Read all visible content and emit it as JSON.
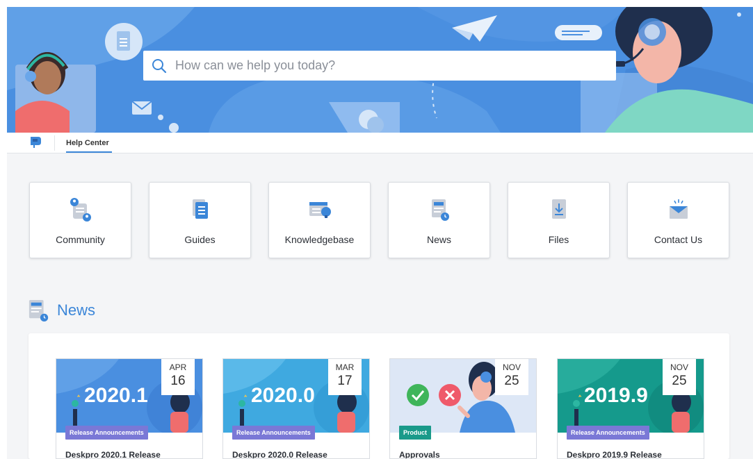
{
  "search": {
    "placeholder": "How can we help you today?"
  },
  "nav": {
    "tabs": [
      {
        "label": "Help Center"
      }
    ]
  },
  "categories": [
    {
      "label": "Community",
      "icon": "community-icon"
    },
    {
      "label": "Guides",
      "icon": "guides-icon"
    },
    {
      "label": "Knowledgebase",
      "icon": "knowledgebase-icon"
    },
    {
      "label": "News",
      "icon": "news-icon"
    },
    {
      "label": "Files",
      "icon": "files-icon"
    },
    {
      "label": "Contact Us",
      "icon": "contact-icon"
    }
  ],
  "news": {
    "heading": "News",
    "items": [
      {
        "month": "APR",
        "day": "16",
        "badge": "Release Announcements",
        "title": "Deskpro 2020.1 Release",
        "version": "2020.1"
      },
      {
        "month": "MAR",
        "day": "17",
        "badge": "Release Announcements",
        "title": "Deskpro 2020.0 Release",
        "version": "2020.0"
      },
      {
        "month": "NOV",
        "day": "25",
        "badge": "Product",
        "title": "Approvals"
      },
      {
        "month": "NOV",
        "day": "25",
        "badge": "Release Announcements",
        "title": "Deskpro 2019.9 Release",
        "version": "2019.9"
      }
    ]
  },
  "colors": {
    "accent": "#3b86d8",
    "hero_blue": "#4a90e2",
    "badge_release": "#7a78d6",
    "badge_product": "#1a9a8a"
  }
}
